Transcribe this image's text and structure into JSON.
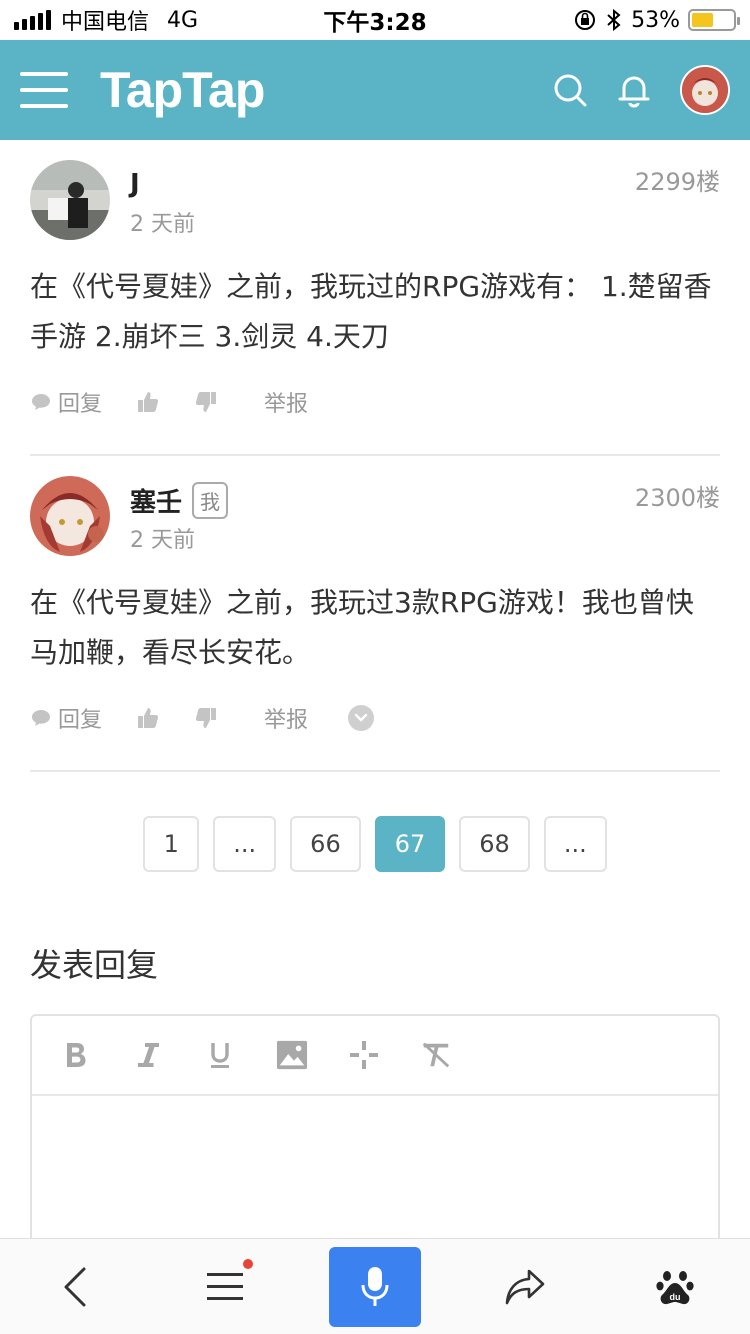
{
  "status": {
    "carrier": "中国电信",
    "network": "4G",
    "time": "下午3:28",
    "battery": "53%",
    "battery_level": 0.53
  },
  "header": {
    "logo": "TapTap"
  },
  "posts": [
    {
      "author": "J",
      "time": "2 天前",
      "floor": "2299楼",
      "body": "在《代号夏娃》之前，我玩过的RPG游戏有： 1.楚留香手游 2.崩坏三 3.剑灵 4.天刀",
      "reply_label": "回复",
      "report_label": "举报"
    },
    {
      "author": "塞壬",
      "badge": "我",
      "time": "2 天前",
      "floor": "2300楼",
      "body": "在《代号夏娃》之前，我玩过3款RPG游戏！我也曾快马加鞭，看尽长安花。",
      "reply_label": "回复",
      "report_label": "举报"
    }
  ],
  "pagination": {
    "pages": [
      "1",
      "...",
      "66",
      "67",
      "68",
      "..."
    ],
    "current": "67"
  },
  "reply": {
    "title": "发表回复"
  },
  "colors": {
    "accent": "#5ab4c5",
    "mic": "#3b82f0",
    "dot": "#e9443a"
  }
}
